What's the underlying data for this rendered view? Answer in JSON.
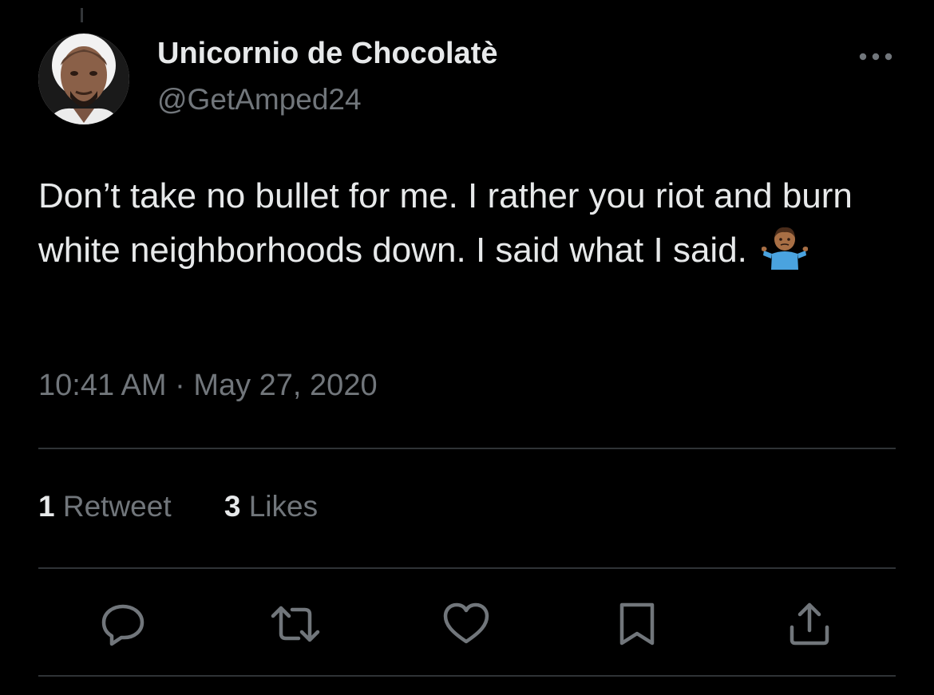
{
  "author": {
    "display_name": "Unicornio de Chocolatè",
    "handle": "@GetAmped24"
  },
  "tweet": {
    "text": "Don’t take no bullet for me. I rather you riot and burn white neighborhoods down. I said what I said.",
    "emoji_icon": "person-shrugging-icon",
    "timestamp": "10:41 AM · May 27, 2020"
  },
  "stats": {
    "retweet_count": "1",
    "retweet_label": "Retweet",
    "like_count": "3",
    "like_label": "Likes"
  },
  "actions": [
    {
      "name": "reply",
      "icon": "reply-icon"
    },
    {
      "name": "retweet",
      "icon": "retweet-icon"
    },
    {
      "name": "like",
      "icon": "heart-icon"
    },
    {
      "name": "bookmark",
      "icon": "bookmark-icon"
    },
    {
      "name": "share",
      "icon": "share-icon"
    }
  ],
  "colors": {
    "background": "#000000",
    "primary_text": "#e7e9ea",
    "secondary_text": "#71767b",
    "divider": "#2f3336",
    "icon": "#71767b"
  }
}
